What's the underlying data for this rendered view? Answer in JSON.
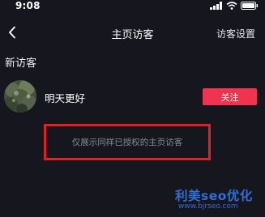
{
  "status_bar": {
    "time": "9:08",
    "icons": [
      "signal-icon",
      "wifi-icon",
      "battery-icon"
    ]
  },
  "nav": {
    "back_icon": "chevron-left-icon",
    "title": "主页访客",
    "action_label": "访客设置"
  },
  "section": {
    "title": "新访客"
  },
  "visitors": [
    {
      "name": "明天更好",
      "follow_label": "关注"
    }
  ],
  "notice": {
    "text": "仅展示同样已授权的主页访客"
  },
  "watermark": {
    "brand": "利美seo优化",
    "url": "www.bjrseo.com"
  },
  "colors": {
    "background": "#16161f",
    "follow_button": "#f0334f",
    "highlight_border": "#e51f24",
    "watermark": "#2f6fd6"
  }
}
